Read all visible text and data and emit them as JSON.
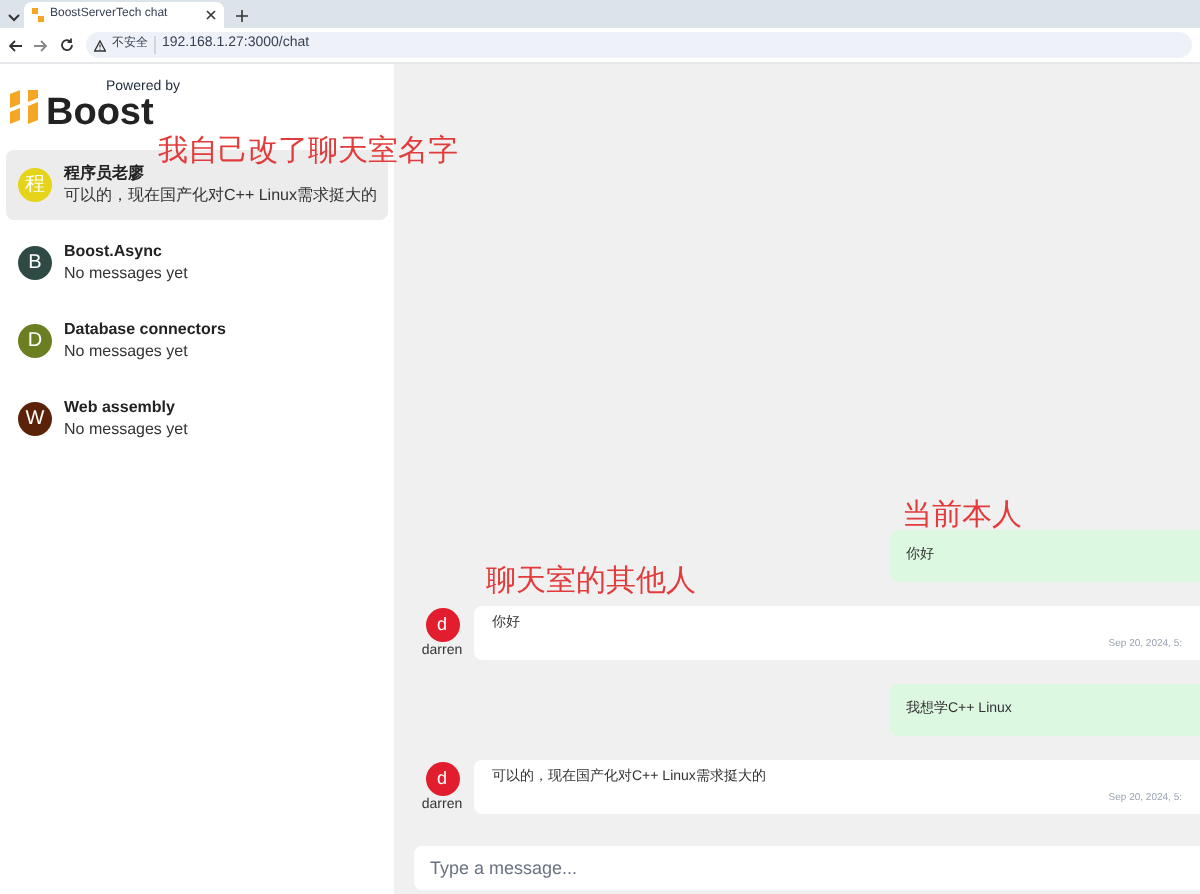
{
  "browser": {
    "tab_title": "BoostServerTech chat",
    "security": "不安全",
    "url": "192.168.1.27:3000/chat"
  },
  "header": {
    "powered_by": "Powered by",
    "brand": "Boost"
  },
  "sidebar": {
    "items": [
      {
        "initial": "程",
        "name": "程序员老廖",
        "preview": "可以的，现在国产化对C++ Linux需求挺大的",
        "color": "#e6d41a",
        "selected": true
      },
      {
        "initial": "B",
        "name": "Boost.Async",
        "preview": "No messages yet",
        "color": "#2f4a44",
        "selected": false
      },
      {
        "initial": "D",
        "name": "Database connectors",
        "preview": "No messages yet",
        "color": "#6b7f22",
        "selected": false
      },
      {
        "initial": "W",
        "name": "Web assembly",
        "preview": "No messages yet",
        "color": "#5a2208",
        "selected": false
      }
    ]
  },
  "messages": [
    {
      "kind": "own",
      "text": "你好"
    },
    {
      "kind": "other",
      "initial": "d",
      "user": "darren",
      "text": "你好",
      "time": "Sep 20, 2024, 5:"
    },
    {
      "kind": "own",
      "text": "我想学C++ Linux"
    },
    {
      "kind": "other",
      "initial": "d",
      "user": "darren",
      "text": "可以的，现在国产化对C++ Linux需求挺大的",
      "time": "Sep 20, 2024, 5:"
    }
  ],
  "composer": {
    "placeholder": "Type a message..."
  },
  "annotations": [
    "我自己改了聊天室名字",
    "当前本人",
    "聊天室的其他人"
  ]
}
